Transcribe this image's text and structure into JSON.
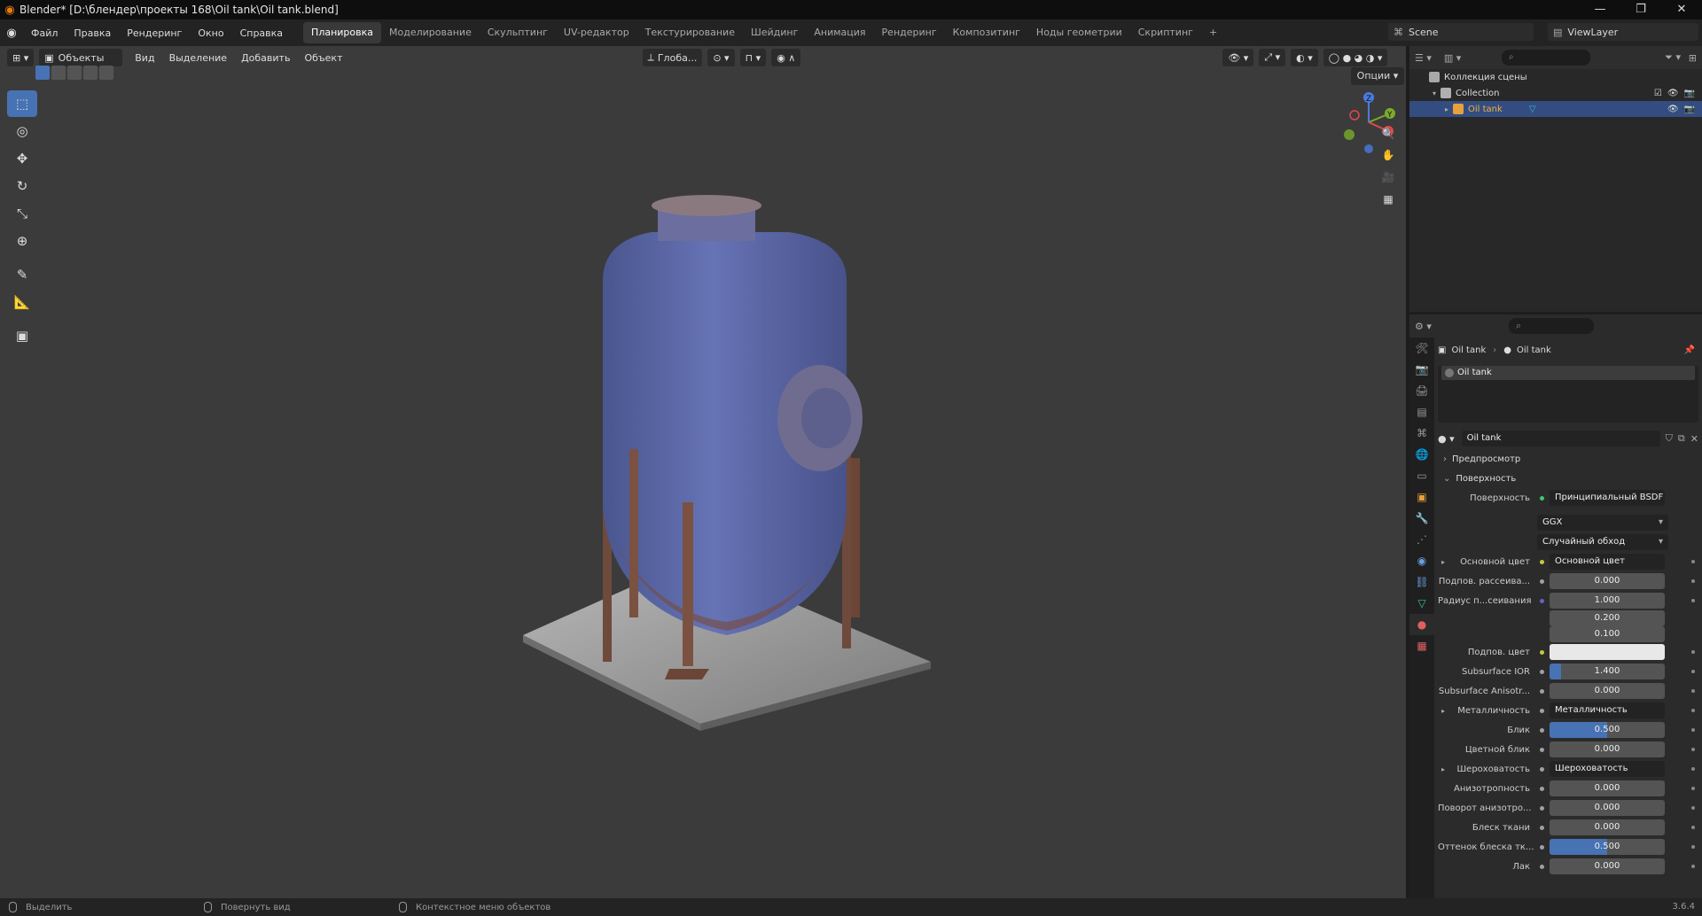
{
  "window": {
    "title": "Blender* [D:\\блендер\\проекты 168\\Oil tank\\Oil tank.blend]",
    "controls": [
      "—",
      "❐",
      "✕"
    ]
  },
  "menubar": {
    "menus": [
      "Файл",
      "Правка",
      "Рендеринг",
      "Окно",
      "Справка"
    ],
    "workspaces": [
      {
        "label": "Планировка",
        "active": true
      },
      {
        "label": "Моделирование"
      },
      {
        "label": "Скульптинг"
      },
      {
        "label": "UV-редактор"
      },
      {
        "label": "Текстурирование"
      },
      {
        "label": "Шейдинг"
      },
      {
        "label": "Анимация"
      },
      {
        "label": "Рендеринг"
      },
      {
        "label": "Композитинг"
      },
      {
        "label": "Ноды геометрии"
      },
      {
        "label": "Скриптинг"
      }
    ],
    "add_tab": "+",
    "scene": "Scene",
    "view_layer": "ViewLayer"
  },
  "viewport": {
    "mode": "Объекты",
    "menus": [
      "Вид",
      "Выделение",
      "Добавить",
      "Объект"
    ],
    "transform_orientation": "Глоба...",
    "options_label": "Опции",
    "tank_colors": {
      "body": "#5c6aa8",
      "rust": "#7a4a3a",
      "base": "#8f8f8f",
      "background": "#3b3b3b"
    }
  },
  "tools": [
    {
      "name": "select-box-icon",
      "glyph": "⬚",
      "active": true
    },
    {
      "name": "cursor-icon",
      "glyph": "◎"
    },
    {
      "name": "move-icon",
      "glyph": "✥"
    },
    {
      "name": "rotate-icon",
      "glyph": "↻"
    },
    {
      "name": "scale-icon",
      "glyph": "⤡"
    },
    {
      "name": "transform-icon",
      "glyph": "⊕"
    },
    {
      "name": "annotate-icon",
      "glyph": "✎"
    },
    {
      "name": "measure-icon",
      "glyph": "📐"
    },
    {
      "name": "add-cube-icon",
      "glyph": "▣"
    }
  ],
  "gizmo": {
    "x": "X",
    "y": "Y",
    "z": "Z"
  },
  "statusbar": {
    "items": [
      "Выделить",
      "Повернуть вид",
      "Контекстное меню объектов"
    ],
    "version": "3.6.4"
  },
  "outliner": {
    "scene_collection": "Коллекция сцены",
    "collection": "Collection",
    "object": "Oil tank"
  },
  "properties": {
    "breadcrumb_object": "Oil tank",
    "breadcrumb_material": "Oil tank",
    "slot": "Oil tank",
    "material_name": "Oil tank",
    "panels": {
      "preview": "Предпросмотр",
      "surface": "Поверхность"
    },
    "surface_label": "Поверхность",
    "surface_value": "Принципиальный BSDF",
    "distribution": "GGX",
    "subsurface_method": "Случайный обход",
    "rows": [
      {
        "label": "Основной цвет",
        "value": "Основной цвет",
        "type": "link",
        "sock": "#c8c83c",
        "arrow": true
      },
      {
        "label": "Подпов. рассеива...",
        "value": "0.000",
        "type": "num",
        "sock": "#a0a0a0"
      },
      {
        "label": "Радиус п...сеивания",
        "value": "1.000",
        "type": "num",
        "sock": "#6363c7"
      },
      {
        "label": "",
        "value": "0.200",
        "type": "num",
        "sock": ""
      },
      {
        "label": "",
        "value": "0.100",
        "type": "num",
        "sock": ""
      },
      {
        "label": "Подпов. цвет",
        "value": "",
        "type": "color",
        "sock": "#c8c83c"
      },
      {
        "label": "Subsurface IOR",
        "value": "1.400",
        "type": "num",
        "sock": "#a0a0a0",
        "fill": 0.1
      },
      {
        "label": "Subsurface Anisotr...",
        "value": "0.000",
        "type": "num",
        "sock": "#a0a0a0"
      },
      {
        "label": "Металличность",
        "value": "Металличность",
        "type": "link",
        "sock": "#a0a0a0",
        "arrow": true
      },
      {
        "label": "Блик",
        "value": "0.500",
        "type": "num",
        "sock": "#a0a0a0",
        "fill": 0.5
      },
      {
        "label": "Цветной блик",
        "value": "0.000",
        "type": "num",
        "sock": "#a0a0a0"
      },
      {
        "label": "Шероховатость",
        "value": "Шероховатость",
        "type": "link",
        "sock": "#a0a0a0",
        "arrow": true
      },
      {
        "label": "Анизотропность",
        "value": "0.000",
        "type": "num",
        "sock": "#a0a0a0"
      },
      {
        "label": "Поворот анизотро...",
        "value": "0.000",
        "type": "num",
        "sock": "#a0a0a0"
      },
      {
        "label": "Блеск ткани",
        "value": "0.000",
        "type": "num",
        "sock": "#a0a0a0"
      },
      {
        "label": "Оттенок блеска тк...",
        "value": "0.500",
        "type": "num",
        "sock": "#a0a0a0",
        "fill": 0.5
      },
      {
        "label": "Лак",
        "value": "0.000",
        "type": "num",
        "sock": "#a0a0a0"
      }
    ]
  }
}
